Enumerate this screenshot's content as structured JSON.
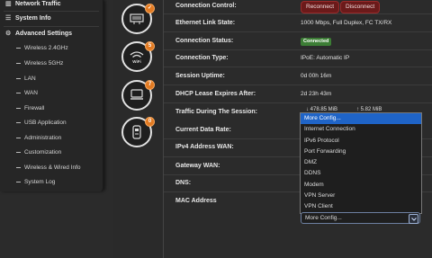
{
  "sidebar": {
    "top": [
      {
        "label": "Network Traffic",
        "icon": "chart-icon"
      },
      {
        "label": "System Info",
        "icon": "info-icon"
      },
      {
        "label": "Advanced Settings",
        "icon": "gear-icon"
      }
    ],
    "items": [
      {
        "label": "Wireless 2.4GHz"
      },
      {
        "label": "Wireless 5GHz"
      },
      {
        "label": "LAN"
      },
      {
        "label": "WAN"
      },
      {
        "label": "Firewall"
      },
      {
        "label": "USB Application"
      },
      {
        "label": "Administration"
      },
      {
        "label": "Customization"
      },
      {
        "label": "Wireless & Wired Info"
      },
      {
        "label": "System Log"
      }
    ]
  },
  "icons": {
    "router": {
      "name": "router-icon",
      "badge": "✓"
    },
    "wifi": {
      "name": "wifi-icon",
      "label": "WiFi",
      "badge": "5"
    },
    "clients": {
      "name": "devices-icon",
      "badge": "7"
    },
    "usb": {
      "name": "usb-icon",
      "badge": "0"
    }
  },
  "rows": {
    "connection_control": {
      "label": "Connection Control:",
      "reconnect": "Reconnect",
      "disconnect": "Disconnect"
    },
    "ethernet": {
      "label": "Ethernet Link State:",
      "value": "1000 Mbps, Full Duplex, FC TX/RX"
    },
    "status": {
      "label": "Connection Status:",
      "value": "Connected"
    },
    "type": {
      "label": "Connection Type:",
      "value": "IPoE: Automatic IP"
    },
    "uptime": {
      "label": "Session Uptime:",
      "value": "0d 00h 16m"
    },
    "dhcp": {
      "label": "DHCP Lease Expires After:",
      "value": "2d 23h 43m"
    },
    "traffic": {
      "label": "Traffic During The Session:",
      "down": "↓ 478.85 MiB",
      "up": "↑ 5.82 MiB"
    },
    "rate": {
      "label": "Current Data Rate:"
    },
    "ipv4": {
      "label": "IPv4 Address WAN:"
    },
    "gateway": {
      "label": "Gateway WAN:"
    },
    "dns": {
      "label": "DNS:"
    },
    "mac": {
      "label": "MAC Address"
    }
  },
  "dropdown": {
    "selected": "More Config...",
    "options": [
      "More Config...",
      "Internet Connection",
      "IPv6 Protocol",
      "Port Forwarding",
      "DMZ",
      "DDNS",
      "Modem",
      "VPN Server",
      "VPN Client"
    ]
  },
  "colors": {
    "accent": "#1f64c7",
    "badge": "#e27a22",
    "connected": "#3c7d35",
    "danger": "#6b1a1a"
  }
}
